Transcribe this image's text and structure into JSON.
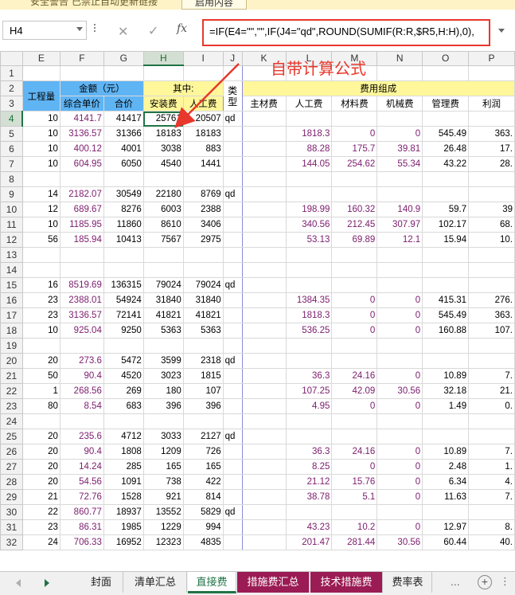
{
  "notice": {
    "title": "安全警告",
    "message": "已禁止自动更新链接",
    "button": "启用内容"
  },
  "formula_bar": {
    "name_box": "H4",
    "cancel_glyph": "✕",
    "confirm_glyph": "✓",
    "fx_label": "fx",
    "formula": "=IF(E4=\"\",\"\",IF(J4=\"qd\",ROUND(SUMIF(R:R,$R5,H:H),0),"
  },
  "annotation": {
    "text": "自带计算公式",
    "color": "#e8372b"
  },
  "columns": [
    "E",
    "F",
    "G",
    "H",
    "I",
    "J",
    "K",
    "L",
    "M",
    "N",
    "O",
    "P"
  ],
  "selected": {
    "column": "H",
    "row": "4"
  },
  "header": {
    "qty": "工程量",
    "amount": "金额（元）",
    "unit_price": "综合单价",
    "total": "合价",
    "among": "其中:",
    "install": "安装费",
    "labor": "人工费",
    "type": "类型",
    "cost_comp": "费用组成",
    "main_mat": "主材费",
    "labor2": "人工费",
    "material": "材料费",
    "machine": "机械费",
    "mgmt": "管理费",
    "profit": "利润"
  },
  "rows": [
    {
      "n": "4",
      "E": "10",
      "F": "4141.7",
      "G": "41417",
      "H": "25761",
      "I": "20507",
      "J": "qd",
      "K": "",
      "L": "",
      "M": "",
      "N": "",
      "O": "",
      "P": ""
    },
    {
      "n": "5",
      "E": "10",
      "F": "3136.57",
      "G": "31366",
      "H": "18183",
      "I": "18183",
      "J": "",
      "K": "",
      "L": "1818.3",
      "M": "0",
      "N": "0",
      "O": "545.49",
      "P": "363."
    },
    {
      "n": "6",
      "E": "10",
      "F": "400.12",
      "G": "4001",
      "H": "3038",
      "I": "883",
      "J": "",
      "K": "",
      "L": "88.28",
      "M": "175.7",
      "N": "39.81",
      "O": "26.48",
      "P": "17."
    },
    {
      "n": "7",
      "E": "10",
      "F": "604.95",
      "G": "6050",
      "H": "4540",
      "I": "1441",
      "J": "",
      "K": "",
      "L": "144.05",
      "M": "254.62",
      "N": "55.34",
      "O": "43.22",
      "P": "28."
    },
    {
      "n": "8",
      "E": "",
      "F": "",
      "G": "",
      "H": "",
      "I": "",
      "J": "",
      "K": "",
      "L": "",
      "M": "",
      "N": "",
      "O": "",
      "P": ""
    },
    {
      "n": "9",
      "E": "14",
      "F": "2182.07",
      "G": "30549",
      "H": "22180",
      "I": "8769",
      "J": "qd",
      "K": "",
      "L": "",
      "M": "",
      "N": "",
      "O": "",
      "P": ""
    },
    {
      "n": "10",
      "E": "12",
      "F": "689.67",
      "G": "8276",
      "H": "6003",
      "I": "2388",
      "J": "",
      "K": "",
      "L": "198.99",
      "M": "160.32",
      "N": "140.9",
      "O": "59.7",
      "P": "39"
    },
    {
      "n": "11",
      "E": "10",
      "F": "1185.95",
      "G": "11860",
      "H": "8610",
      "I": "3406",
      "J": "",
      "K": "",
      "L": "340.56",
      "M": "212.45",
      "N": "307.97",
      "O": "102.17",
      "P": "68."
    },
    {
      "n": "12",
      "E": "56",
      "F": "185.94",
      "G": "10413",
      "H": "7567",
      "I": "2975",
      "J": "",
      "K": "",
      "L": "53.13",
      "M": "69.89",
      "N": "12.1",
      "O": "15.94",
      "P": "10."
    },
    {
      "n": "13",
      "E": "",
      "F": "",
      "G": "",
      "H": "",
      "I": "",
      "J": "",
      "K": "",
      "L": "",
      "M": "",
      "N": "",
      "O": "",
      "P": ""
    },
    {
      "n": "14",
      "E": "",
      "F": "",
      "G": "",
      "H": "",
      "I": "",
      "J": "",
      "K": "",
      "L": "",
      "M": "",
      "N": "",
      "O": "",
      "P": ""
    },
    {
      "n": "15",
      "E": "16",
      "F": "8519.69",
      "G": "136315",
      "H": "79024",
      "I": "79024",
      "J": "qd",
      "K": "",
      "L": "",
      "M": "",
      "N": "",
      "O": "",
      "P": ""
    },
    {
      "n": "16",
      "E": "23",
      "F": "2388.01",
      "G": "54924",
      "H": "31840",
      "I": "31840",
      "J": "",
      "K": "",
      "L": "1384.35",
      "M": "0",
      "N": "0",
      "O": "415.31",
      "P": "276."
    },
    {
      "n": "17",
      "E": "23",
      "F": "3136.57",
      "G": "72141",
      "H": "41821",
      "I": "41821",
      "J": "",
      "K": "",
      "L": "1818.3",
      "M": "0",
      "N": "0",
      "O": "545.49",
      "P": "363."
    },
    {
      "n": "18",
      "E": "10",
      "F": "925.04",
      "G": "9250",
      "H": "5363",
      "I": "5363",
      "J": "",
      "K": "",
      "L": "536.25",
      "M": "0",
      "N": "0",
      "O": "160.88",
      "P": "107."
    },
    {
      "n": "19",
      "E": "",
      "F": "",
      "G": "",
      "H": "",
      "I": "",
      "J": "",
      "K": "",
      "L": "",
      "M": "",
      "N": "",
      "O": "",
      "P": ""
    },
    {
      "n": "20",
      "E": "20",
      "F": "273.6",
      "G": "5472",
      "H": "3599",
      "I": "2318",
      "J": "qd",
      "K": "",
      "L": "",
      "M": "",
      "N": "",
      "O": "",
      "P": ""
    },
    {
      "n": "21",
      "E": "50",
      "F": "90.4",
      "G": "4520",
      "H": "3023",
      "I": "1815",
      "J": "",
      "K": "",
      "L": "36.3",
      "M": "24.16",
      "N": "0",
      "O": "10.89",
      "P": "7."
    },
    {
      "n": "22",
      "E": "1",
      "F": "268.56",
      "G": "269",
      "H": "180",
      "I": "107",
      "J": "",
      "K": "",
      "L": "107.25",
      "M": "42.09",
      "N": "30.56",
      "O": "32.18",
      "P": "21."
    },
    {
      "n": "23",
      "E": "80",
      "F": "8.54",
      "G": "683",
      "H": "396",
      "I": "396",
      "J": "",
      "K": "",
      "L": "4.95",
      "M": "0",
      "N": "0",
      "O": "1.49",
      "P": "0."
    },
    {
      "n": "24",
      "E": "",
      "F": "",
      "G": "",
      "H": "",
      "I": "",
      "J": "",
      "K": "",
      "L": "",
      "M": "",
      "N": "",
      "O": "",
      "P": ""
    },
    {
      "n": "25",
      "E": "20",
      "F": "235.6",
      "G": "4712",
      "H": "3033",
      "I": "2127",
      "J": "qd",
      "K": "",
      "L": "",
      "M": "",
      "N": "",
      "O": "",
      "P": ""
    },
    {
      "n": "26",
      "E": "20",
      "F": "90.4",
      "G": "1808",
      "H": "1209",
      "I": "726",
      "J": "",
      "K": "",
      "L": "36.3",
      "M": "24.16",
      "N": "0",
      "O": "10.89",
      "P": "7."
    },
    {
      "n": "27",
      "E": "20",
      "F": "14.24",
      "G": "285",
      "H": "165",
      "I": "165",
      "J": "",
      "K": "",
      "L": "8.25",
      "M": "0",
      "N": "0",
      "O": "2.48",
      "P": "1."
    },
    {
      "n": "28",
      "E": "20",
      "F": "54.56",
      "G": "1091",
      "H": "738",
      "I": "422",
      "J": "",
      "K": "",
      "L": "21.12",
      "M": "15.76",
      "N": "0",
      "O": "6.34",
      "P": "4."
    },
    {
      "n": "29",
      "E": "21",
      "F": "72.76",
      "G": "1528",
      "H": "921",
      "I": "814",
      "J": "",
      "K": "",
      "L": "38.78",
      "M": "5.1",
      "N": "0",
      "O": "11.63",
      "P": "7."
    },
    {
      "n": "30",
      "E": "22",
      "F": "860.77",
      "G": "18937",
      "H": "13552",
      "I": "5829",
      "J": "qd",
      "K": "",
      "L": "",
      "M": "",
      "N": "",
      "O": "",
      "P": ""
    },
    {
      "n": "31",
      "E": "23",
      "F": "86.31",
      "G": "1985",
      "H": "1229",
      "I": "994",
      "J": "",
      "K": "",
      "L": "43.23",
      "M": "10.2",
      "N": "0",
      "O": "12.97",
      "P": "8."
    },
    {
      "n": "32",
      "E": "24",
      "F": "706.33",
      "G": "16952",
      "H": "12323",
      "I": "4835",
      "J": "",
      "K": "",
      "L": "201.47",
      "M": "281.44",
      "N": "30.56",
      "O": "60.44",
      "P": "40."
    }
  ],
  "tabs": [
    {
      "label": "封面",
      "style": "normal"
    },
    {
      "label": "清单汇总",
      "style": "normal"
    },
    {
      "label": "直接费",
      "style": "active"
    },
    {
      "label": "措施费汇总",
      "style": "maroon"
    },
    {
      "label": "技术措施费",
      "style": "maroon"
    },
    {
      "label": "费率表",
      "style": "normal"
    }
  ],
  "tab_more": "...",
  "tab_add": "+"
}
